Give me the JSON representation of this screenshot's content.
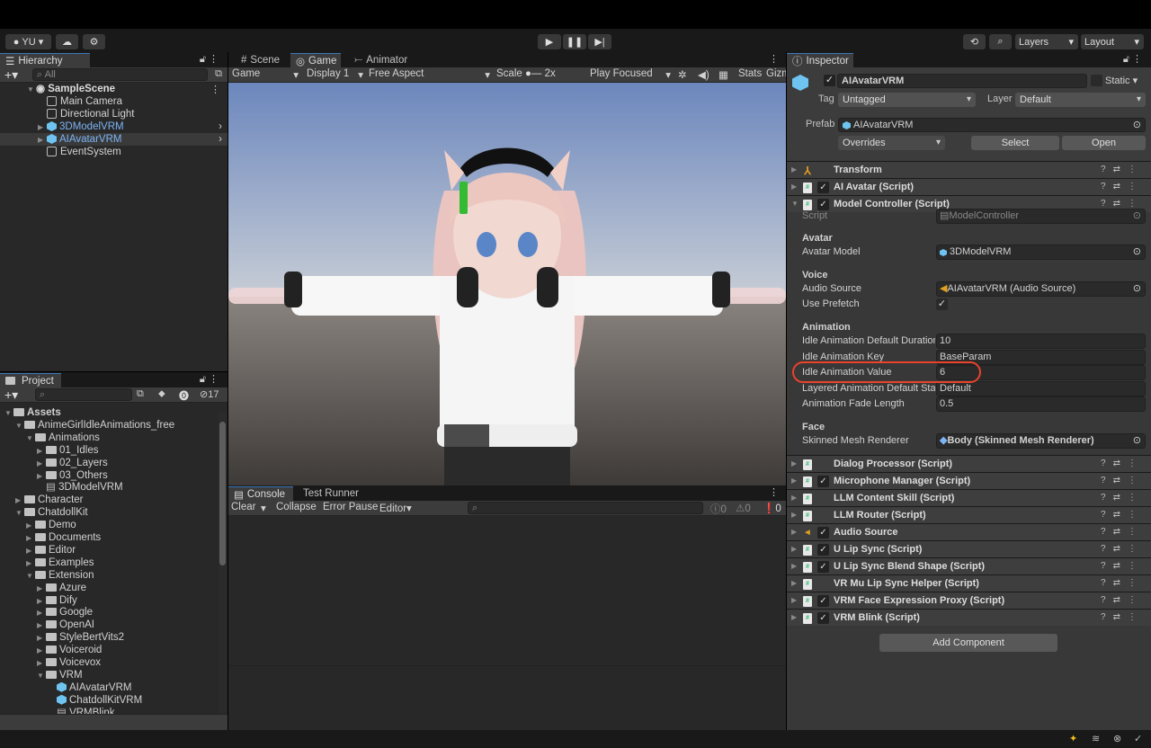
{
  "toolbar": {
    "account": "YU",
    "layers": "Layers",
    "layout": "Layout"
  },
  "hierarchy": {
    "tab": "Hierarchy",
    "search_placeholder": "All",
    "scene": "SampleScene",
    "items": [
      {
        "label": "Main Camera",
        "prefab": false
      },
      {
        "label": "Directional Light",
        "prefab": false
      },
      {
        "label": "3DModelVRM",
        "prefab": true
      },
      {
        "label": "AIAvatarVRM",
        "prefab": true,
        "selected": true
      },
      {
        "label": "EventSystem",
        "prefab": false
      }
    ]
  },
  "project": {
    "tab": "Project",
    "hidden_count": "17",
    "tree": [
      {
        "label": "Assets",
        "depth": 0,
        "type": "folder",
        "open": true
      },
      {
        "label": "AnimeGirlIdleAnimations_free",
        "depth": 1,
        "type": "folder",
        "open": true
      },
      {
        "label": "Animations",
        "depth": 2,
        "type": "folder",
        "open": true
      },
      {
        "label": "01_Idles",
        "depth": 3,
        "type": "folder"
      },
      {
        "label": "02_Layers",
        "depth": 3,
        "type": "folder"
      },
      {
        "label": "03_Others",
        "depth": 3,
        "type": "folder"
      },
      {
        "label": "3DModelVRM",
        "depth": 3,
        "type": "file"
      },
      {
        "label": "Character",
        "depth": 1,
        "type": "folder"
      },
      {
        "label": "ChatdollKit",
        "depth": 1,
        "type": "folder",
        "open": true
      },
      {
        "label": "Demo",
        "depth": 2,
        "type": "folder"
      },
      {
        "label": "Documents",
        "depth": 2,
        "type": "folder"
      },
      {
        "label": "Editor",
        "depth": 2,
        "type": "folder"
      },
      {
        "label": "Examples",
        "depth": 2,
        "type": "folder"
      },
      {
        "label": "Extension",
        "depth": 2,
        "type": "folder",
        "open": true
      },
      {
        "label": "Azure",
        "depth": 3,
        "type": "folder"
      },
      {
        "label": "Dify",
        "depth": 3,
        "type": "folder"
      },
      {
        "label": "Google",
        "depth": 3,
        "type": "folder"
      },
      {
        "label": "OpenAI",
        "depth": 3,
        "type": "folder"
      },
      {
        "label": "StyleBertVits2",
        "depth": 3,
        "type": "folder"
      },
      {
        "label": "Voiceroid",
        "depth": 3,
        "type": "folder"
      },
      {
        "label": "Voicevox",
        "depth": 3,
        "type": "folder"
      },
      {
        "label": "VRM",
        "depth": 3,
        "type": "folder",
        "open": true
      },
      {
        "label": "AIAvatarVRM",
        "depth": 4,
        "type": "prefab"
      },
      {
        "label": "ChatdollKitVRM",
        "depth": 4,
        "type": "prefab"
      },
      {
        "label": "VRMBlink",
        "depth": 4,
        "type": "file"
      }
    ]
  },
  "view": {
    "tabs": [
      "Scene",
      "Game",
      "Animator"
    ],
    "mode": "Game",
    "display": "Display 1",
    "aspect": "Free Aspect",
    "scale_label": "Scale",
    "scale": "2x",
    "play_mode": "Play Focused",
    "stats": "Stats",
    "gizmos": "Gizmos"
  },
  "console": {
    "tabs": [
      "Console",
      "Test Runner"
    ],
    "clear": "Clear",
    "collapse": "Collapse",
    "error_pause": "Error Pause",
    "editor": "Editor",
    "logs": "0",
    "warnings": "0",
    "errors": "0"
  },
  "inspector": {
    "tab": "Inspector",
    "name": "AIAvatarVRM",
    "static": "Static",
    "tag_label": "Tag",
    "tag": "Untagged",
    "layer_label": "Layer",
    "layer": "Default",
    "prefab_label": "Prefab",
    "prefab": "AIAvatarVRM",
    "overrides": "Overrides",
    "select": "Select",
    "open": "Open",
    "components_top": [
      {
        "label": "Transform",
        "check": false,
        "icon": "transform"
      },
      {
        "label": "AI Avatar (Script)",
        "check": true,
        "icon": "script"
      },
      {
        "label": "Model Controller (Script)",
        "check": true,
        "icon": "script",
        "open": true
      }
    ],
    "script_label": "Script",
    "script": "ModelController",
    "avatar_section": "Avatar",
    "avatar_model_label": "Avatar Model",
    "avatar_model": "3DModelVRM",
    "voice_section": "Voice",
    "audio_source_label": "Audio Source",
    "audio_source": "AIAvatarVRM (Audio Source)",
    "use_prefetch_label": "Use Prefetch",
    "use_prefetch": true,
    "animation_section": "Animation",
    "animation_fields": [
      {
        "label": "Idle Animation Default Duration",
        "value": "10"
      },
      {
        "label": "Idle Animation Key",
        "value": "BaseParam"
      },
      {
        "label": "Idle Animation Value",
        "value": "6",
        "highlighted": true
      },
      {
        "label": "Layered Animation Default State",
        "value": "Default"
      },
      {
        "label": "Animation Fade Length",
        "value": "0.5"
      }
    ],
    "face_section": "Face",
    "skinned_label": "Skinned Mesh Renderer",
    "skinned": "Body (Skinned Mesh Renderer)",
    "components_bottom": [
      {
        "label": "Dialog Processor (Script)",
        "check": false
      },
      {
        "label": "Microphone Manager (Script)",
        "check": true
      },
      {
        "label": "LLM Content Skill (Script)",
        "check": false
      },
      {
        "label": "LLM Router (Script)",
        "check": false
      },
      {
        "label": "Audio Source",
        "check": true,
        "icon": "audio"
      },
      {
        "label": "U Lip Sync (Script)",
        "check": true
      },
      {
        "label": "U Lip Sync Blend Shape (Script)",
        "check": true
      },
      {
        "label": "VR Mu Lip Sync Helper (Script)",
        "check": false
      },
      {
        "label": "VRM Face Expression Proxy (Script)",
        "check": true
      },
      {
        "label": "VRM Blink (Script)",
        "check": true
      }
    ],
    "add_component": "Add Component"
  },
  "colors": {
    "highlight": "#e8432c",
    "accent": "#3a79bb",
    "prefab": "#7cb4f5"
  }
}
